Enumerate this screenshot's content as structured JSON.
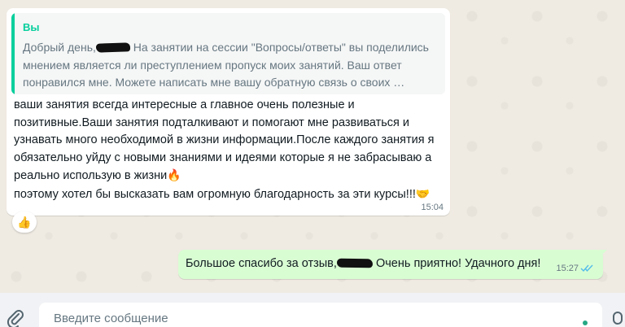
{
  "incoming": {
    "quote": {
      "author": "Вы",
      "line1_before": "Добрый день,",
      "line1_after": " На занятии на сессии \"Вопросы/ответы\" вы поделились",
      "line2": "мнением является ли преступлением пропуск моих занятий. Ваш ответ",
      "line3": "понравился мне. Можете написать мне вашу обратную связь о своих …"
    },
    "lines": [
      "ваши занятия всегда интересные а главное очень полезные и",
      "позитивные.Ваши занятия подталкивают и помогают мне развиваться и",
      "узнавать много необходимой в жизни информации.После каждого занятия я",
      "обязательно уйду с новыми знаниями и идеями которые я не забрасываю а",
      "реально использую в жизни",
      "поэтому хотел бы  высказать вам огромную благодарность за эти курсы!!!"
    ],
    "emoji_fire": "🔥",
    "emoji_handshake": "🤝",
    "time": "15:04",
    "reaction": "👍"
  },
  "outgoing": {
    "text_before": "Большое спасибо за отзыв,",
    "text_after": " Очень приятно! Удачного дня!",
    "time": "15:27"
  },
  "composer": {
    "placeholder": "Введите сообщение"
  },
  "colors": {
    "accent": "#06cf9c",
    "outgoing_bubble": "#d9fdd3",
    "read_ticks": "#53bdeb"
  }
}
